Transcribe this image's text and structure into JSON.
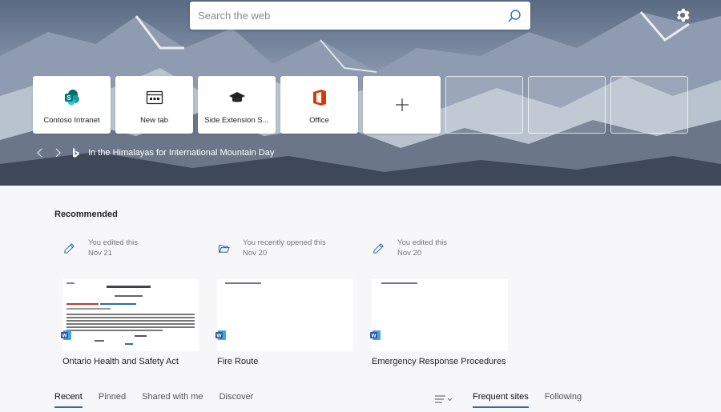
{
  "search": {
    "placeholder": "Search the web",
    "icon": "search-icon"
  },
  "settings": {
    "icon": "gear-icon"
  },
  "tiles": [
    {
      "label": "Contoso Intranet",
      "icon": "sharepoint-icon"
    },
    {
      "label": "New tab",
      "icon": "new-tab-icon"
    },
    {
      "label": "Side Extension S...",
      "icon": "graduation-cap-icon"
    },
    {
      "label": "Office",
      "icon": "office-icon"
    }
  ],
  "add_tile": {
    "icon": "plus-icon"
  },
  "caption": {
    "text": "In the Himalayas for International Mountain Day",
    "icon": "bing-icon"
  },
  "recommended": {
    "title": "Recommended",
    "cards": [
      {
        "activity": "You edited this",
        "date": "Nov 21",
        "title": "Ontario Health and Safety Act",
        "activity_icon": "pencil-icon"
      },
      {
        "activity": "You recently opened this",
        "date": "Nov 20",
        "title": "Fire Route",
        "activity_icon": "folder-open-icon"
      },
      {
        "activity": "You edited this",
        "date": "Nov 20",
        "title": "Emergency Response Procedures",
        "activity_icon": "pencil-icon"
      }
    ]
  },
  "tabs_left": [
    "Recent",
    "Pinned",
    "Shared with me",
    "Discover"
  ],
  "tabs_right": [
    "Frequent sites",
    "Following"
  ],
  "colors": {
    "accent": "#2b6cb0",
    "word_blue": "#2b579a",
    "office_red": "#d83b01",
    "sharepoint_teal": "#038387"
  }
}
